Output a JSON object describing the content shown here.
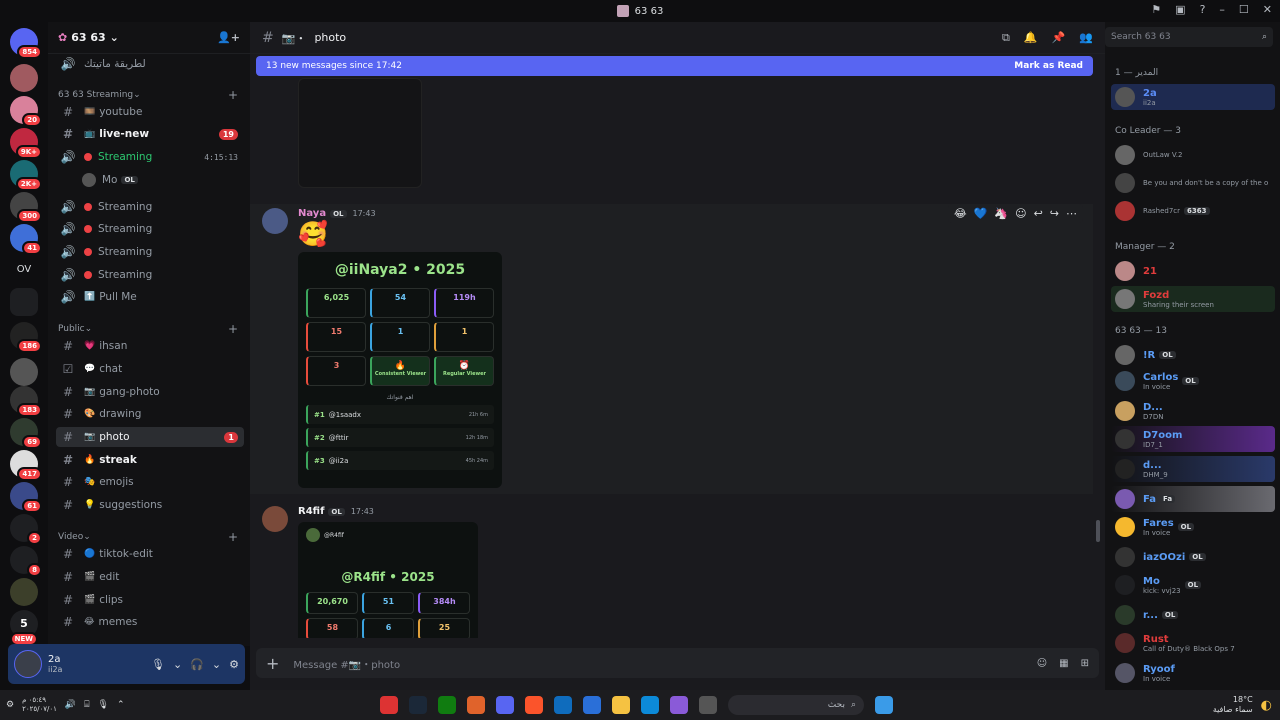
{
  "window": {
    "title": "63 63"
  },
  "server": {
    "name": "63 63",
    "top_channel": "لطريقة ماتيتك"
  },
  "server_badges": [
    "854",
    "20",
    "9K+",
    "2K+",
    "300",
    "41",
    "OV",
    "186",
    "183",
    "69",
    "417",
    "61",
    "2",
    "8",
    "NEW"
  ],
  "categories": {
    "streaming": "63 63 Streaming",
    "public": "Public",
    "video": "Video"
  },
  "channels": [
    {
      "name": "youtube"
    },
    {
      "name": "live-new",
      "count": "19"
    },
    {
      "name": "Streaming",
      "time": "4:15:13"
    },
    {
      "name": "Mo",
      "tag": "OL"
    },
    {
      "name": "Streaming"
    },
    {
      "name": "Streaming"
    },
    {
      "name": "Streaming"
    },
    {
      "name": "Streaming"
    },
    {
      "name": "Pull Me"
    },
    {
      "name": "ihsan"
    },
    {
      "name": "chat"
    },
    {
      "name": "gang-photo"
    },
    {
      "name": "drawing"
    },
    {
      "name": "photo",
      "count": "1"
    },
    {
      "name": "streak"
    },
    {
      "name": "emojis"
    },
    {
      "name": "suggestions"
    },
    {
      "name": "tiktok-edit"
    },
    {
      "name": "edit"
    },
    {
      "name": "clips"
    },
    {
      "name": "memes"
    }
  ],
  "user": {
    "name": "2a",
    "status": "ii2a"
  },
  "channel_header": {
    "name": "photo"
  },
  "new_messages": {
    "text": "13 new messages since 17:42",
    "action": "Mark as Read"
  },
  "messages": [
    {
      "author": "Naya",
      "tag": "OL",
      "time": "17:43",
      "emoji": "🥰",
      "card": {
        "title": "@iiNaya2 • 2025",
        "stats": [
          "6,025",
          "54",
          "119h",
          "15",
          "1",
          "1",
          "3",
          "Consistent Viewer",
          "Regular Viewer"
        ],
        "section": "اهم قنواتك",
        "ranks": [
          {
            "n": "#1",
            "name": "@1saadx",
            "v": "21h 6m"
          },
          {
            "n": "#2",
            "name": "@fttir",
            "v": "12h 18m"
          },
          {
            "n": "#3",
            "name": "@ii2a",
            "v": "45h 24m"
          }
        ]
      }
    },
    {
      "author": "R4fif",
      "tag": "OL",
      "time": "17:43",
      "card": {
        "title": "@R4fif • 2025",
        "header_name": "@R4fif",
        "stats": [
          "20,670",
          "51",
          "384h",
          "58",
          "6",
          "25"
        ]
      }
    }
  ],
  "composer": {
    "placeholder": "Message #📷・photo"
  },
  "search": {
    "placeholder": "Search 63 63"
  },
  "member_groups": {
    "g1": "المدير — 1",
    "g2": "Co Leader — 3",
    "g3": "Manager — 2",
    "g4": "63 63 — 13"
  },
  "members": [
    {
      "name": "2a",
      "sub": "ii2a"
    },
    {
      "name": "",
      "sub": "OutLaw V.2"
    },
    {
      "name": "",
      "sub": "Be you and don't be a copy of the o..."
    },
    {
      "name": "",
      "sub": "Rashed7cr",
      "tag": "6363"
    },
    {
      "name": "21",
      "sub": ""
    },
    {
      "name": "Fozd",
      "sub": "Sharing their screen"
    },
    {
      "name": "!R",
      "sub": "",
      "tag": "OL"
    },
    {
      "name": "Carlos",
      "sub": "In voice",
      "tag": "OL"
    },
    {
      "name": "D...",
      "sub": "D7DN"
    },
    {
      "name": "D7oom",
      "sub": "ID7_1"
    },
    {
      "name": "d...",
      "sub": "DHM_9"
    },
    {
      "name": "Fa",
      "sub": "",
      "tag": "Fa"
    },
    {
      "name": "Fares",
      "sub": "In voice",
      "tag": "OL"
    },
    {
      "name": "iazOOzi",
      "sub": "",
      "tag": "OL"
    },
    {
      "name": "Mo",
      "sub": "kick: vvj23",
      "tag": "OL"
    },
    {
      "name": "r...",
      "sub": "",
      "tag": "OL"
    },
    {
      "name": "Rust",
      "sub": "Call of Duty® Black Ops 7",
      "tag": "OL"
    },
    {
      "name": "Ryoof",
      "sub": "In voice"
    }
  ],
  "taskbar": {
    "date": "٢٠٢٥/٠٧/٠١",
    "time": "٠٥:٤٩ م",
    "search": "بحث",
    "temp": "18°C",
    "weather": "سماء صافية"
  },
  "colors": {
    "accent": "#5865f2",
    "bg": "#1a1a1e",
    "sidebar": "#121214"
  }
}
